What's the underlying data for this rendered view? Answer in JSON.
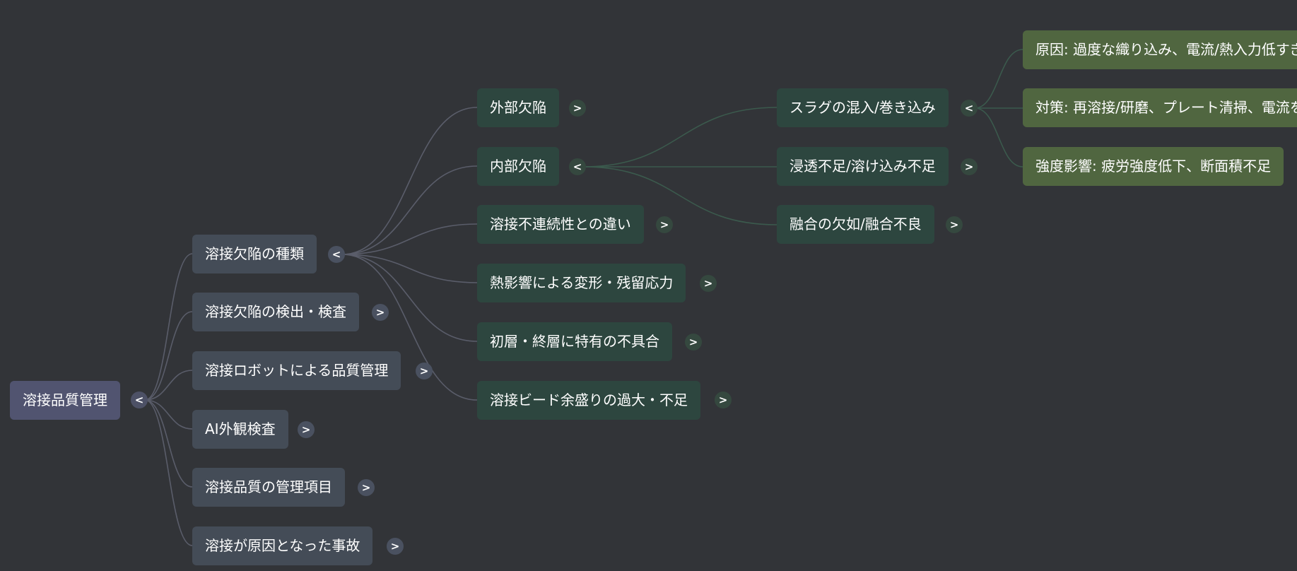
{
  "root": {
    "label": "溶接品質管理",
    "toggle": "<"
  },
  "level1": [
    {
      "label": "溶接欠陥の種類",
      "toggle": "<"
    },
    {
      "label": "溶接欠陥の検出・検査",
      "toggle": ">"
    },
    {
      "label": "溶接ロボットによる品質管理",
      "toggle": ">"
    },
    {
      "label": "AI外観検査",
      "toggle": ">"
    },
    {
      "label": "溶接品質の管理項目",
      "toggle": ">"
    },
    {
      "label": "溶接が原因となった事故",
      "toggle": ">"
    }
  ],
  "level2": [
    {
      "label": "外部欠陥",
      "toggle": ">"
    },
    {
      "label": "内部欠陥",
      "toggle": "<"
    },
    {
      "label": "溶接不連続性との違い",
      "toggle": ">"
    },
    {
      "label": "熱影響による変形・残留応力",
      "toggle": ">"
    },
    {
      "label": "初層・終層に特有の不具合",
      "toggle": ">"
    },
    {
      "label": "溶接ビード余盛りの過大・不足",
      "toggle": ">"
    }
  ],
  "level3": [
    {
      "label": "スラグの混入/巻き込み",
      "toggle": "<"
    },
    {
      "label": "浸透不足/溶け込み不足",
      "toggle": ">"
    },
    {
      "label": "融合の欠如/融合不良",
      "toggle": ">"
    }
  ],
  "level4": [
    {
      "label": "原因: 過度な織り込み、電流/熱入力低すぎ"
    },
    {
      "label": "対策: 再溶接/研磨、プレート清掃、電流を上げる"
    },
    {
      "label": "強度影響: 疲労強度低下、断面積不足"
    }
  ],
  "colors": {
    "background": "#323438",
    "root_node": "#515470",
    "level1_node": "#444c57",
    "level2_node": "#2d463f",
    "level4_node": "#506640",
    "link_gray": "#5a5d6a",
    "link_green": "#3b5a4d"
  }
}
